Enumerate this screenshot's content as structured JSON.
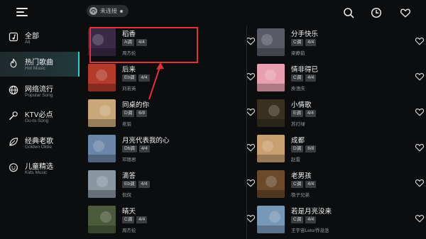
{
  "header": {
    "connection_status": "未连接"
  },
  "sidebar": {
    "items": [
      {
        "zh": "全部",
        "en": "All",
        "icon": "music-note-icon",
        "active": false
      },
      {
        "zh": "热门歌曲",
        "en": "Hot Music",
        "icon": "flame-icon",
        "active": true
      },
      {
        "zh": "网络流行",
        "en": "Popular Song",
        "icon": "globe-icon",
        "active": false
      },
      {
        "zh": "KTV必点",
        "en": "Go-to Song",
        "icon": "microphone-icon",
        "active": false
      },
      {
        "zh": "经典老歌",
        "en": "Golden Oldie",
        "icon": "leaf-icon",
        "active": false
      },
      {
        "zh": "儿童精选",
        "en": "Kids Music",
        "icon": "smiley-icon",
        "active": false
      }
    ]
  },
  "songs_left": [
    {
      "title": "稻香",
      "key": "A调",
      "meter": "4/4",
      "artist": "周杰伦",
      "cover": "#3a2a48"
    },
    {
      "title": "后来",
      "key": "Eb调",
      "meter": "4/4",
      "artist": "刘若英",
      "cover": "#b43a2a"
    },
    {
      "title": "同桌的你",
      "key": "D调",
      "meter": "6/8",
      "artist": "老狼",
      "cover": "#c8a878"
    },
    {
      "title": "月亮代表我的心",
      "key": "Db调",
      "meter": "4/4",
      "artist": "邓丽君",
      "cover": "#6b86a8"
    },
    {
      "title": "滴答",
      "key": "Eb调",
      "meter": "4/4",
      "artist": "侃侃",
      "cover": "#8a96a0"
    },
    {
      "title": "晴天",
      "key": "C调",
      "meter": "4/4",
      "artist": "周杰伦",
      "cover": "#4a5a3a"
    }
  ],
  "songs_right": [
    {
      "title": "分手快乐",
      "key": "C调",
      "meter": "4/4",
      "artist": "梁静茹",
      "cover": "#5a5a66"
    },
    {
      "title": "情非得已",
      "key": "C调",
      "meter": "4/4",
      "artist": "庾澄庆",
      "cover": "#e8a0b0"
    },
    {
      "title": "小情歌",
      "key": "E调",
      "meter": "4/4",
      "artist": "苏打绿",
      "cover": "#3a3020"
    },
    {
      "title": "成都",
      "key": "D调",
      "meter": "6/8",
      "artist": "赵雷",
      "cover": "#c8a070"
    },
    {
      "title": "老男孩",
      "key": "C调",
      "meter": "4/4",
      "artist": "筷子兄弟",
      "cover": "#6a4a2a"
    },
    {
      "title": "若是月亮没来",
      "key": "C调",
      "meter": "4/4",
      "artist": "王宇宙Leto/乔浚丞",
      "cover": "#7898b8"
    }
  ],
  "colors": {
    "accent": "#2fd0c2",
    "highlight": "#e0323a",
    "background": "#0b0d0f"
  }
}
